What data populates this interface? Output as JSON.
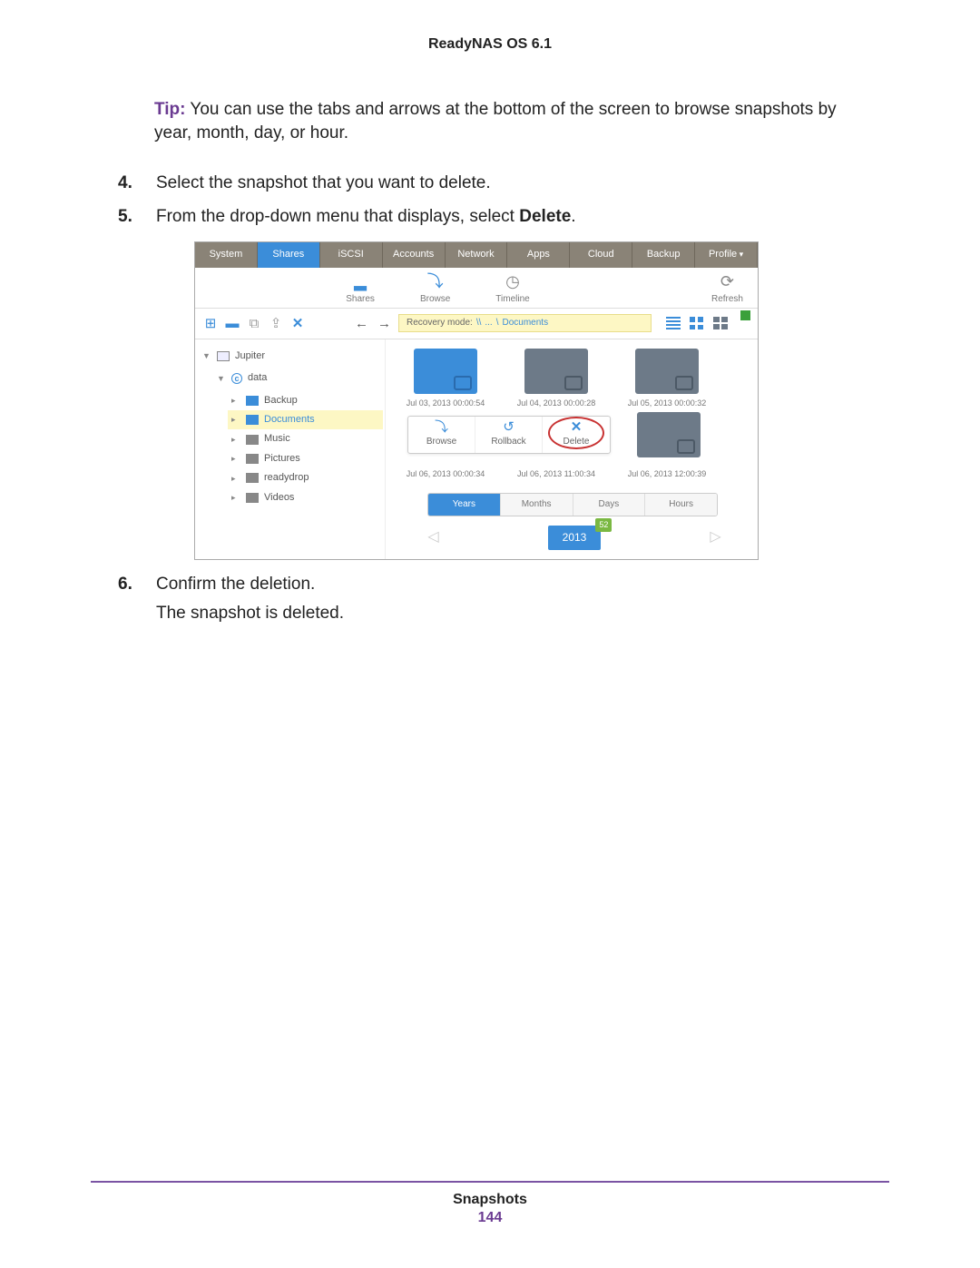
{
  "doc": {
    "header": "ReadyNAS OS 6.1",
    "footer_section": "Snapshots",
    "page_number": "144"
  },
  "tip": {
    "label": "Tip:",
    "text": "You can use the tabs and arrows at the bottom of the screen to browse snapshots by year, month, day, or hour."
  },
  "steps": {
    "s4_num": "4.",
    "s4": "Select the snapshot that you want to delete.",
    "s5_num": "5.",
    "s5_a": "From the drop-down menu that displays, select ",
    "s5_b": "Delete",
    "s5_c": ".",
    "s6_num": "6.",
    "s6": "Confirm the deletion.",
    "s6_sub": "The snapshot is deleted."
  },
  "ui": {
    "topnav": [
      "System",
      "Shares",
      "iSCSI",
      "Accounts",
      "Network",
      "Apps",
      "Cloud",
      "Backup",
      "Profile"
    ],
    "topnav_active": "Shares",
    "subnav": {
      "shares": "Shares",
      "browse": "Browse",
      "timeline": "Timeline",
      "refresh": "Refresh"
    },
    "breadcrumb": {
      "mode": "Recovery mode:",
      "sep1": "\\\\",
      "mid": "...",
      "sep2": "\\",
      "leaf": "Documents"
    },
    "tree": {
      "host": "Jupiter",
      "volume": "data",
      "folders": [
        "Backup",
        "Documents",
        "Music",
        "Pictures",
        "readydrop",
        "Videos"
      ],
      "selected": "Documents"
    },
    "snapshots": {
      "row1": [
        "Jul 03, 2013 00:00:54",
        "Jul 04, 2013 00:00:28",
        "Jul 05, 2013 00:00:32"
      ],
      "row2": [
        "Jul 06, 2013 00:00:34",
        "Jul 06, 2013 11:00:34",
        "Jul 06, 2013 12:00:39"
      ]
    },
    "ctx": {
      "browse": "Browse",
      "rollback": "Rollback",
      "delete": "Delete"
    },
    "time_tabs": [
      "Years",
      "Months",
      "Days",
      "Hours"
    ],
    "year": "2013",
    "year_badge": "52"
  }
}
